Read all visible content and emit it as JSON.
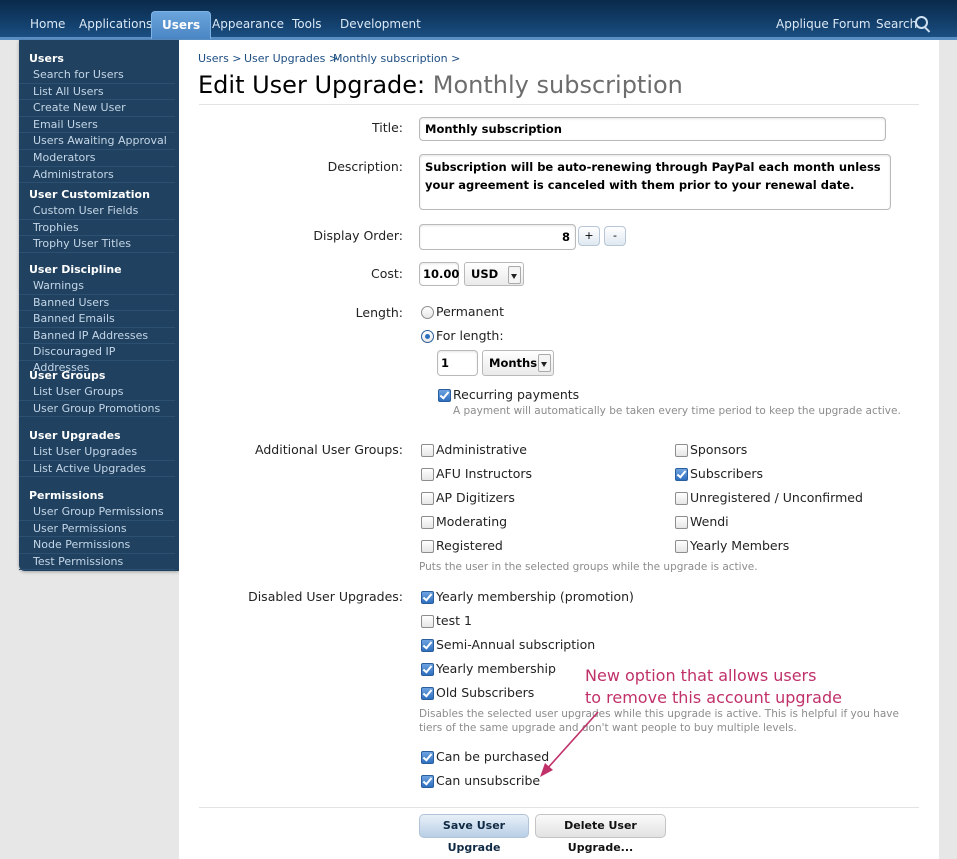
{
  "nav": {
    "tabs": [
      "Home",
      "Applications",
      "Users",
      "Appearance",
      "Tools",
      "Development"
    ],
    "active_tab": "Users",
    "forum_link": "Applique Forum",
    "search_label": "Search"
  },
  "sidebar": {
    "sections": [
      {
        "title": "Users",
        "items": [
          "Search for Users",
          "List All Users",
          "Create New User",
          "Email Users",
          "Users Awaiting Approval",
          "Moderators",
          "Administrators"
        ]
      },
      {
        "title": "User Customization",
        "items": [
          "Custom User Fields",
          "Trophies",
          "Trophy User Titles"
        ]
      },
      {
        "title": "User Discipline",
        "items": [
          "Warnings",
          "Banned Users",
          "Banned Emails",
          "Banned IP Addresses",
          "Discouraged IP Addresses"
        ]
      },
      {
        "title": "User Groups",
        "items": [
          "List User Groups",
          "User Group Promotions"
        ]
      },
      {
        "title": "User Upgrades",
        "items": [
          "List User Upgrades",
          "List Active Upgrades"
        ]
      },
      {
        "title": "Permissions",
        "items": [
          "User Group Permissions",
          "User Permissions",
          "Node Permissions",
          "Test Permissions"
        ]
      }
    ]
  },
  "breadcrumb": [
    "Users >",
    "User Upgrades >",
    "Monthly subscription >"
  ],
  "page_title": {
    "prefix": "Edit User Upgrade:",
    "name": "Monthly subscription"
  },
  "form": {
    "title_label": "Title:",
    "title_value": "Monthly subscription",
    "description_label": "Description:",
    "description_value": "Subscription will be auto-renewing through PayPal each month unless your agreement is canceled with them prior to your renewal date.",
    "display_order_label": "Display Order:",
    "display_order_value": "8",
    "plus": "+",
    "minus": "-",
    "cost_label": "Cost:",
    "cost_value": "10.00",
    "currency": "USD",
    "length_label": "Length:",
    "length_permanent": "Permanent",
    "length_for": "For length:",
    "length_amount": "1",
    "length_unit": "Months",
    "recurring_label": "Recurring payments",
    "recurring_hint": "A payment will automatically be taken every time period to keep the upgrade active.",
    "groups_label": "Additional User Groups:",
    "groups_left": [
      {
        "label": "Administrative",
        "checked": false
      },
      {
        "label": "AFU Instructors",
        "checked": false
      },
      {
        "label": "AP Digitizers",
        "checked": false
      },
      {
        "label": "Moderating",
        "checked": false
      },
      {
        "label": "Registered",
        "checked": false
      }
    ],
    "groups_right": [
      {
        "label": "Sponsors",
        "checked": false
      },
      {
        "label": "Subscribers",
        "checked": true
      },
      {
        "label": "Unregistered / Unconfirmed",
        "checked": false
      },
      {
        "label": "Wendi",
        "checked": false
      },
      {
        "label": "Yearly Members",
        "checked": false
      }
    ],
    "groups_hint": "Puts the user in the selected groups while the upgrade is active.",
    "disabled_label": "Disabled User Upgrades:",
    "disabled_items": [
      {
        "label": "Yearly membership (promotion)",
        "checked": true
      },
      {
        "label": "test 1",
        "checked": false
      },
      {
        "label": "Semi-Annual subscription",
        "checked": true
      },
      {
        "label": "Yearly membership",
        "checked": true
      },
      {
        "label": "Old Subscribers",
        "checked": true
      }
    ],
    "disabled_hint_1": "Disables the selected user upgrades while this upgrade is active. This is helpful if you have",
    "disabled_hint_2": "tiers of the same upgrade and don't want people to buy multiple levels.",
    "can_purchase": "Can be purchased",
    "can_unsubscribe": "Can unsubscribe",
    "save_button": "Save User Upgrade",
    "delete_button": "Delete User Upgrade..."
  },
  "annotation": {
    "line1": "New option that allows users",
    "line2": "to remove this account upgrade",
    "color": "#c03169"
  }
}
